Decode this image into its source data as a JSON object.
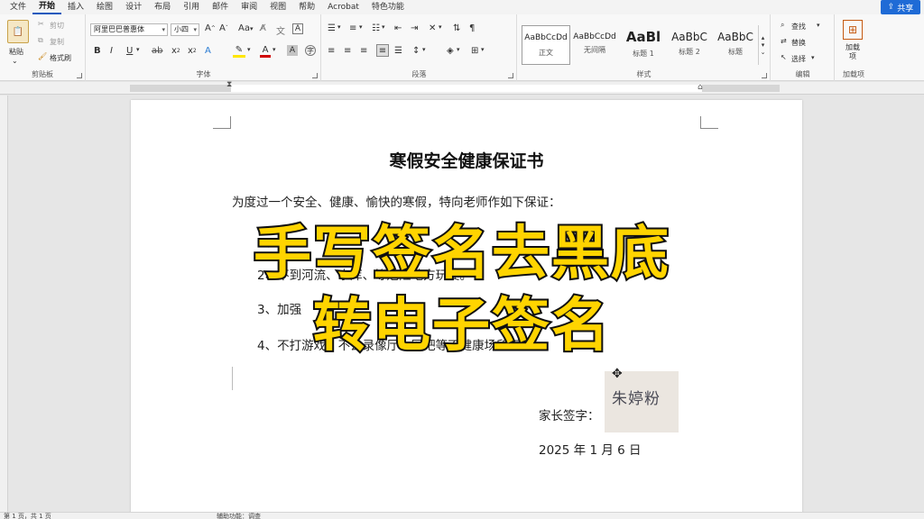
{
  "menu": {
    "tabs": [
      "文件",
      "开始",
      "插入",
      "绘图",
      "设计",
      "布局",
      "引用",
      "邮件",
      "审阅",
      "视图",
      "帮助",
      "Acrobat",
      "特色功能"
    ],
    "share_label": "共享"
  },
  "clipboard": {
    "paste": "粘贴",
    "cut": "剪切",
    "copy": "复制",
    "format_painter": "格式刷",
    "group_label": "剪贴板"
  },
  "font": {
    "font_name": "阿里巴巴普惠体",
    "font_size": "小四",
    "group_label": "字体"
  },
  "paragraph": {
    "group_label": "段落"
  },
  "styles": {
    "items": [
      {
        "sample": "AaBbCcDd",
        "name": "正文"
      },
      {
        "sample": "AaBbCcDd",
        "name": "无间隔"
      },
      {
        "sample": "AaBl",
        "name": "标题 1"
      },
      {
        "sample": "AaBbC",
        "name": "标题 2"
      },
      {
        "sample": "AaBbC",
        "name": "标题"
      }
    ],
    "group_label": "样式"
  },
  "editing": {
    "find": "查找",
    "replace": "替换",
    "select": "选择",
    "group_label": "编辑"
  },
  "addins": {
    "button": "加载项",
    "group_label": "加载项"
  },
  "document": {
    "title": "寒假安全健康保证书",
    "intro": "为度过一个安全、健康、愉快的寒假，特向老师作如下保证：",
    "item1": "1、",
    "item2": "2、不到河流、水库、等危险地方玩耍。",
    "item3": "3、加强",
    "item4": "4、不打游戏、不去录像厅、网吧等不健康场所玩耍。",
    "signature_label": "家长签字：",
    "signature_name": "朱婷粉",
    "date": "2025 年 1 月 6 日"
  },
  "overlay": {
    "line1": "手写签名去黑底",
    "line2": "转电子签名"
  },
  "status": {
    "page": "第 1 页，共 1 页",
    "mode": "辅助功能：调查"
  },
  "colors": {
    "accent": "#185abd",
    "caption_fill": "#ffd400",
    "caption_stroke": "#111111"
  }
}
